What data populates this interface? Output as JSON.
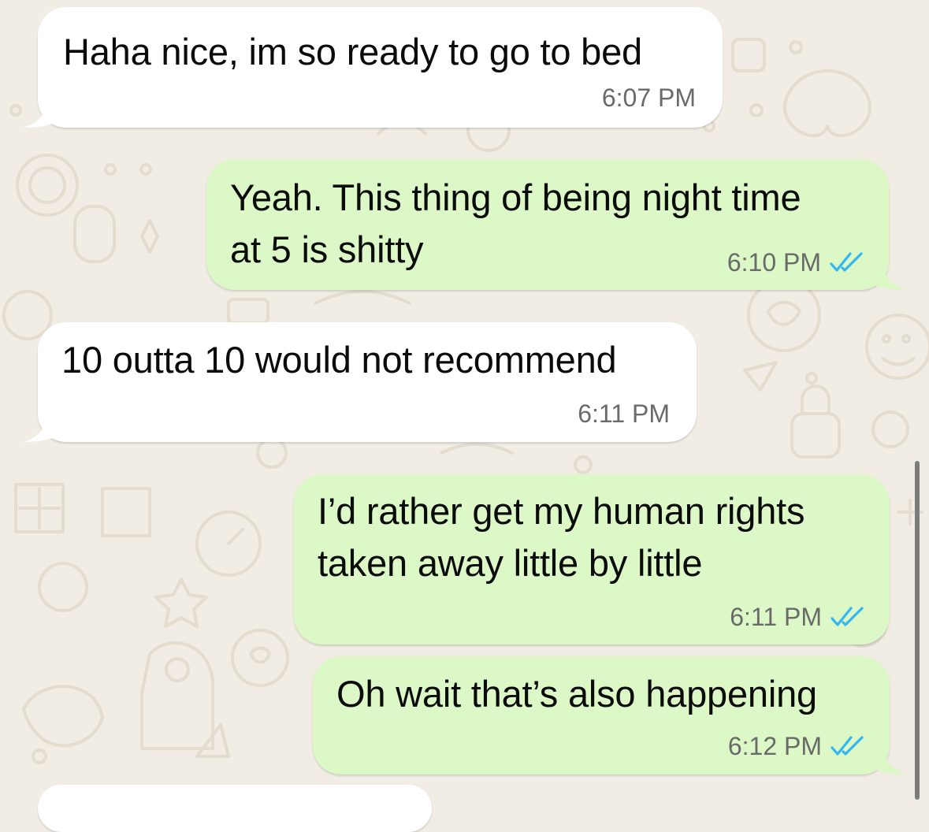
{
  "chat": {
    "messages": [
      {
        "direction": "incoming",
        "lines": [
          "Haha nice, im so ready to go to bed"
        ],
        "time": "6:07 PM"
      },
      {
        "direction": "outgoing",
        "lines": [
          "Yeah. This thing of being night time",
          "at 5 is shitty"
        ],
        "time": "6:10 PM",
        "status": "read"
      },
      {
        "direction": "incoming",
        "lines": [
          "10 outta 10 would not recommend"
        ],
        "time": "6:11 PM"
      },
      {
        "direction": "outgoing",
        "lines": [
          "I’d rather get my human rights",
          "taken away little by little"
        ],
        "time": "6:11 PM",
        "status": "read"
      },
      {
        "direction": "outgoing",
        "lines": [
          "Oh wait that’s also happening"
        ],
        "time": "6:12 PM",
        "status": "read"
      }
    ]
  },
  "icons": {
    "read_receipt": "double-check-icon"
  },
  "colors": {
    "background": "#f1ece4",
    "incoming_bubble": "#ffffff",
    "outgoing_bubble": "#dcf8c6",
    "read_tick": "#34b7f1",
    "timestamp": "#6a6a6a"
  }
}
